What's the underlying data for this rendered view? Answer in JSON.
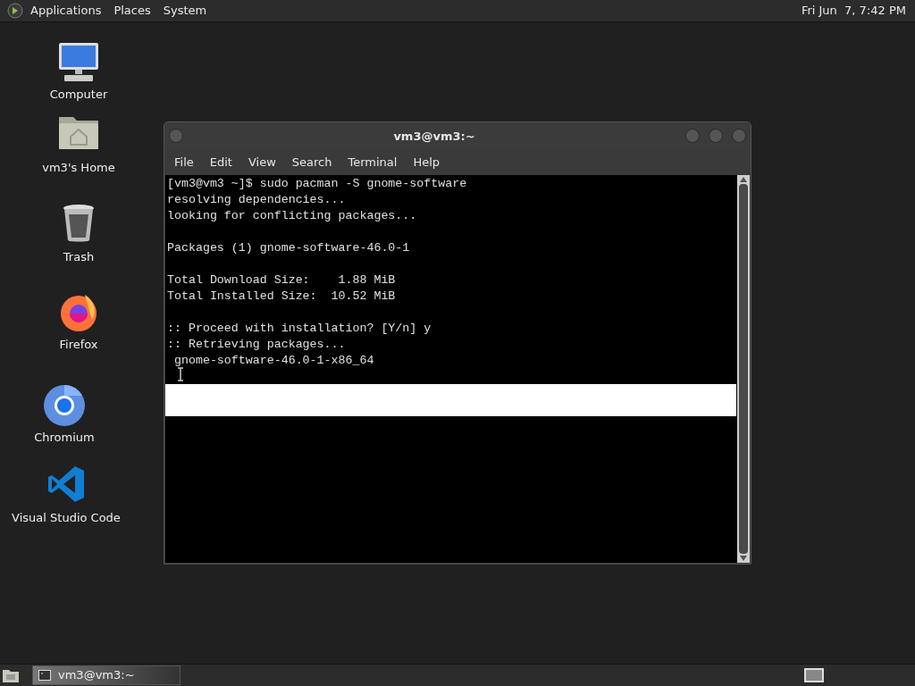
{
  "top_panel": {
    "menus": [
      "Applications",
      "Places",
      "System"
    ],
    "clock": "Fri Jun  7, 7:42 PM"
  },
  "desktop_icons": [
    {
      "label": "Computer",
      "kind": "computer"
    },
    {
      "label": "vm3's Home",
      "kind": "home"
    },
    {
      "label": "Trash",
      "kind": "trash"
    },
    {
      "label": "Firefox",
      "kind": "firefox"
    },
    {
      "label": "Chromium",
      "kind": "chromium"
    },
    {
      "label": "Visual Studio Code",
      "kind": "vscode"
    }
  ],
  "terminal": {
    "title": "vm3@vm3:~",
    "menu": [
      "File",
      "Edit",
      "View",
      "Search",
      "Terminal",
      "Help"
    ],
    "paragraphs": [
      [
        "[vm3@vm3 ~]$ sudo pacman -S gnome-software",
        "resolving dependencies...",
        "looking for conflicting packages..."
      ],
      [
        "Packages (1) gnome-software-46.0-1"
      ],
      [
        "Total Download Size:    1.88 MiB",
        "Total Installed Size:  10.52 MiB"
      ],
      [
        ":: Proceed with installation? [Y/n] y",
        ":: Retrieving packages...",
        " gnome-software-46.0-1-x86_64"
      ]
    ]
  },
  "taskbar": {
    "tasks": [
      {
        "label": "vm3@vm3:~",
        "selected": true
      }
    ]
  }
}
